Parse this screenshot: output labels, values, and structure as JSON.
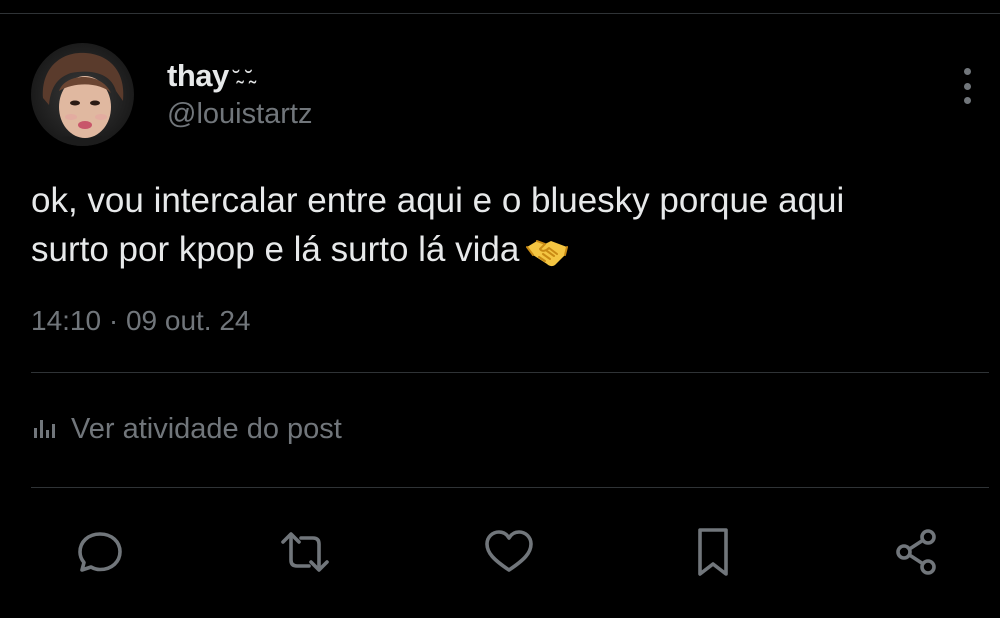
{
  "user": {
    "display_name": "thay",
    "name_decoration": "˘̴ ˘̴",
    "handle": "@louistartz",
    "avatar_icon": "profile-avatar"
  },
  "tweet": {
    "text_line1": "ok, vou intercalar entre aqui e o bluesky porque aqui",
    "text_line2": "surto por kpop e lá surto lá vida",
    "emoji": "handshake-emoji",
    "timestamp": "14:10 · 09 out. 24"
  },
  "activity": {
    "label": "Ver atividade do post",
    "icon": "analytics-bars-icon"
  },
  "actions": [
    {
      "name": "reply",
      "icon": "speech-bubble-icon"
    },
    {
      "name": "repost",
      "icon": "repost-arrows-icon"
    },
    {
      "name": "like",
      "icon": "heart-icon"
    },
    {
      "name": "bookmark",
      "icon": "bookmark-icon"
    },
    {
      "name": "share",
      "icon": "share-nodes-icon"
    }
  ],
  "colors": {
    "background": "#000000",
    "text_primary": "#e7e9ea",
    "text_secondary": "#71767b",
    "divider": "#2f3336",
    "emoji_gold": "#f4c542"
  }
}
